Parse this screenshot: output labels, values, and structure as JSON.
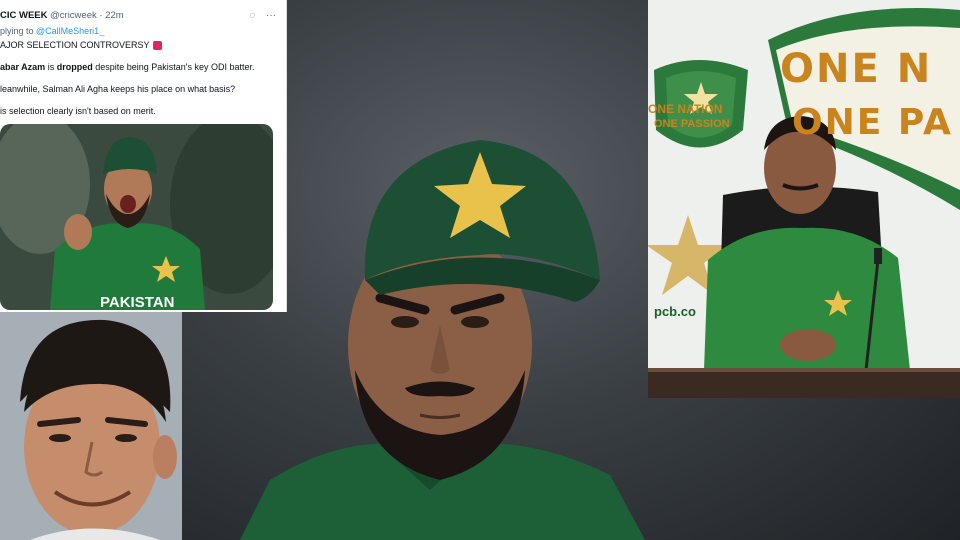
{
  "tweet": {
    "name": "CIC WEEK",
    "handle": "@cricweek",
    "time": "· 22m",
    "replying_prefix": "plying to ",
    "replying_to": "@CallMeSheri1_",
    "line1": "AJOR SELECTION CONTROVERSY",
    "line2_name": "abar Azam",
    "line2_mid": " is ",
    "line2_bold": "dropped",
    "line2_rest": " despite being Pakistan's key ODI batter.",
    "line3": "leanwhile, Salman Ali Agha keeps his place on what basis?",
    "line4": "is selection clearly isn't based on merit.",
    "image_shirt_text": "PAKISTAN"
  },
  "presser": {
    "banner_line1": "ONE N",
    "banner_line2": "ONE PA",
    "logo_line1": "ONE NATION",
    "logo_line2": "ONE PASSION",
    "site": "pcb.co"
  },
  "icons": [
    "grok-icon",
    "more-icon"
  ],
  "colors": {
    "pakistan_green": "#1f6b3a",
    "cap_green": "#1d4f34",
    "star_gold": "#e8c24a",
    "banner_orange": "#c9841d",
    "twitter_blue": "#1d9bf0"
  }
}
